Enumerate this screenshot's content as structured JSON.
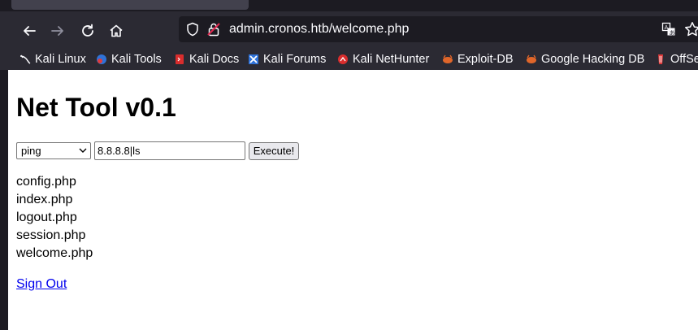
{
  "browser": {
    "url": "admin.cronos.htb/welcome.php",
    "bookmarks": [
      {
        "label": "Kali Linux",
        "icon": "kali-dragon-icon"
      },
      {
        "label": "Kali Tools",
        "icon": "kali-tools-icon"
      },
      {
        "label": "Kali Docs",
        "icon": "kali-docs-icon"
      },
      {
        "label": "Kali Forums",
        "icon": "kali-forums-icon"
      },
      {
        "label": "Kali NetHunter",
        "icon": "kali-nethunter-icon"
      },
      {
        "label": "Exploit-DB",
        "icon": "exploit-db-icon"
      },
      {
        "label": "Google Hacking DB",
        "icon": "ghdb-icon"
      },
      {
        "label": "OffSe",
        "icon": "offsec-icon"
      }
    ]
  },
  "page": {
    "title": "Net Tool v0.1",
    "tool_select": "ping",
    "command_input": "8.8.8.8|ls",
    "execute_label": "Execute!",
    "output": [
      "config.php",
      "index.php",
      "logout.php",
      "session.php",
      "welcome.php"
    ],
    "signout_label": "Sign Out"
  },
  "colors": {
    "browser_chrome": "#2b2a33",
    "urlbar": "#1c1b22",
    "link": "#0000ee"
  }
}
